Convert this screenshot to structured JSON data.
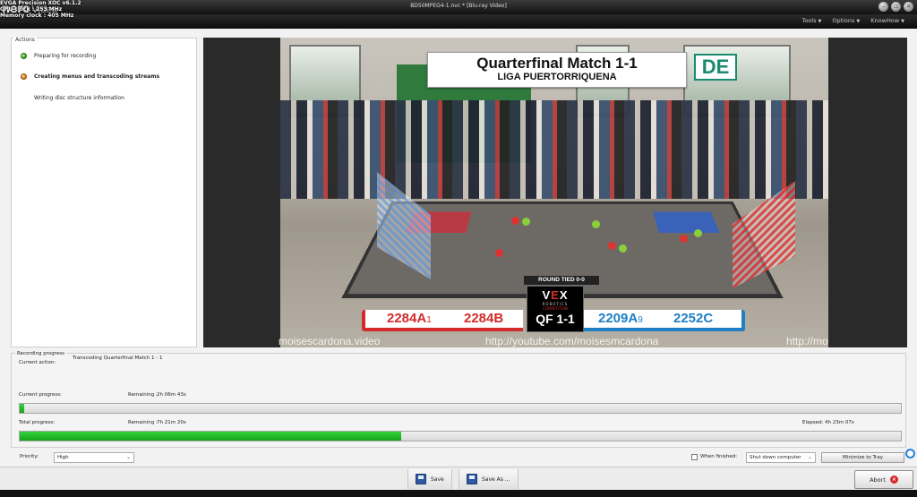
{
  "overlay": {
    "app": "EVGA Precision XOC  v6.1.2",
    "gpu_clock": "GPU clock : 253 MHz",
    "memory_clock": "Memory clock : 405 MHz"
  },
  "window": {
    "logo": "nero",
    "logo_sub": "Video",
    "title": "BD50MPEG4-1.nvc * [Blu-ray Video]"
  },
  "menu": {
    "tools": "Tools",
    "options": "Options",
    "knowhow": "KnowHow"
  },
  "actions": {
    "legend": "Actions",
    "items": [
      {
        "label": "Preparing for recording",
        "state": "done"
      },
      {
        "label": "Creating menus and transcoding streams",
        "state": "active"
      },
      {
        "label": "Writing disc structure information",
        "state": "pending"
      }
    ]
  },
  "preview": {
    "title": "Quarterfinal Match 1-1",
    "subtitle": "LIGA PUERTORRIQUENA",
    "logo": "DE",
    "round_status": "ROUND TIED 0-0",
    "vex_top": "VEX",
    "vex_sub": "ROBOTICS",
    "vex_sub2": "COMPETITION",
    "qf": "QF 1-1",
    "red_team_1": "2284A",
    "red_team_1_rank": "1",
    "red_team_2": "2284B",
    "blue_team_1": "2209A",
    "blue_team_1_rank": "9",
    "blue_team_2": "2252C",
    "watermark_left": "moisescardona.video",
    "watermark_center": "http://youtube.com/moisesmcardona",
    "watermark_right": "http://mo"
  },
  "progress": {
    "legend": "Recording progress",
    "current_action_label": "Current action:",
    "current_action": "Transcoding Quarterfinal Match 1 - 1",
    "current_progress_label": "Current progress:",
    "current_remaining_label": "Remaining :",
    "current_remaining": "2h 06m 43s",
    "current_progress_fraction": 0.005,
    "total_progress_label": "Total progress:",
    "total_remaining_label": "Remaining :",
    "total_remaining": "7h 21m 20s",
    "elapsed_label": "Elapsed:",
    "elapsed": "4h 23m 07s",
    "total_progress_fraction": 0.433
  },
  "controls": {
    "priority_label": "Priority:",
    "priority_value": "High",
    "when_finished_label": "When finished:",
    "when_finished_value": "Shut down computer",
    "minimize_label": "Minimize to Tray"
  },
  "toolbar": {
    "save": "Save",
    "save_as": "Save As ...",
    "abort": "Abort"
  },
  "colors": {
    "progress_green": "#14a51a",
    "red_alliance": "#d32b2b",
    "blue_alliance": "#1e7fc6"
  }
}
